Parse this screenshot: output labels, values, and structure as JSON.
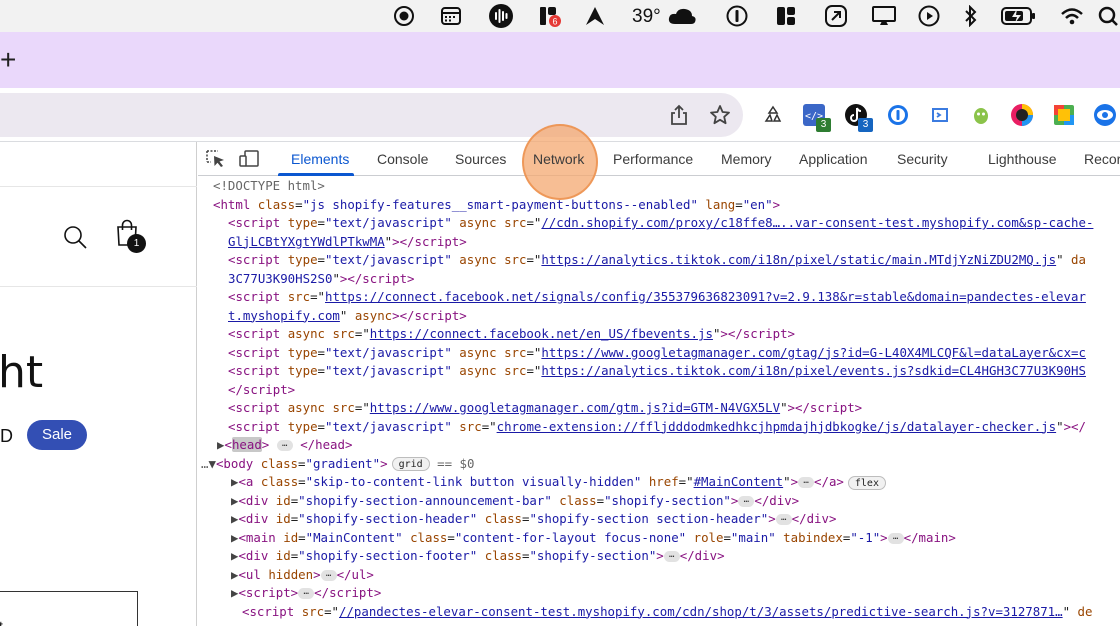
{
  "menubar": {
    "temperature": "39°",
    "icons": [
      "record-icon",
      "calendar-icon",
      "audio-waves-icon",
      "notification-app-icon",
      "arrow-a-icon",
      "cloud-icon",
      "onepassword-icon",
      "layout-icon",
      "chain-link-app-icon",
      "display-icon",
      "play-icon",
      "bluetooth-icon",
      "battery-icon",
      "wifi-icon",
      "search-icon"
    ]
  },
  "tabstrip": {
    "new_tab_label": "+"
  },
  "toolbar": {
    "icons": [
      "share-icon",
      "bookmark-star-icon"
    ],
    "extensions": [
      {
        "name": "recycle-extension-icon",
        "badge": ""
      },
      {
        "name": "code-extension-icon",
        "badge": "3"
      },
      {
        "name": "tiktok-extension-icon",
        "badge": "3"
      },
      {
        "name": "onepassword-extension-icon",
        "badge": ""
      },
      {
        "name": "inspector-extension-icon",
        "badge": ""
      },
      {
        "name": "bug-extension-icon",
        "badge": ""
      },
      {
        "name": "colorpicker-extension-icon",
        "badge": ""
      },
      {
        "name": "tag-assistant-extension-icon",
        "badge": ""
      },
      {
        "name": "eye-extension-icon",
        "badge": ""
      }
    ],
    "badge_colors": {
      "green": "#2e7d32",
      "blue": "#1565c0"
    }
  },
  "page": {
    "heading_fragment": "ht",
    "price_fragment": "D",
    "sale_label": "Sale",
    "cart_count": "1",
    "input_fragment": "t"
  },
  "devtools": {
    "tabs": [
      "Elements",
      "Console",
      "Sources",
      "Network",
      "Performance",
      "Memory",
      "Application",
      "Security",
      "Lighthouse",
      "Recor"
    ],
    "active_tab": "Elements",
    "dom": {
      "doctype": "<!DOCTYPE html>",
      "html_class": "\"js shopify-features__smart-payment-buttons--enabled\"",
      "html_lang": "\"en\"",
      "s1_url_a": "//cdn.shopify.com/proxy/c18ffe8…..var-consent-test.myshopify.com&sp-cache-",
      "s1_url_b": "GljLCBtYXgtYWdlPTkwMA",
      "s2_url": "https://analytics.tiktok.com/i18n/pixel/static/main.MTdjYzNiZDU2MQ.js",
      "s2_cont": "3C77U3K90HS2S0",
      "s3_url_a": "https://connect.facebook.net/signals/config/355379636823091?v=2.9.138&r=stable&domain=pandectes-elevar",
      "s3_url_b": "t.myshopify.com",
      "s4_url": "https://connect.facebook.net/en_US/fbevents.js",
      "s5_url": "https://www.googletagmanager.com/gtag/js?id=G-L40X4MLCQF&l=dataLayer&cx=c",
      "s6_url": "https://analytics.tiktok.com/i18n/pixel/events.js?sdkid=CL4HGH3C77U3K90HS",
      "s7_url": "https://www.googletagmanager.com/gtm.js?id=GTM-N4VGX5LV",
      "s8_url": "chrome-extension://ffljdddodmkedhkcjhpmdajhjdbkogke/js/datalayer-checker.js",
      "text_javascript": "\"text/javascript\"",
      "body_class": "\"gradient\"",
      "grid_badge": "grid",
      "dollar_zero": "== $0",
      "a_class": "\"skip-to-content-link button visually-hidden\"",
      "a_href": "#MainContent",
      "flex_badge": "flex",
      "div1_id": "\"shopify-section-announcement-bar\"",
      "div1_class": "\"shopify-section\"",
      "div2_id": "\"shopify-section-header\"",
      "div2_class": "\"shopify-section section-header\"",
      "main_id": "\"MainContent\"",
      "main_class": "\"content-for-layout focus-none\"",
      "main_role": "\"main\"",
      "main_tabindex": "\"-1\"",
      "div3_id": "\"shopify-section-footer\"",
      "div3_class": "\"shopify-section\"",
      "ps_url": "//pandectes-elevar-consent-test.myshopify.com/cdn/shop/t/3/assets/predictive-search.js?v=3127871…"
    }
  }
}
